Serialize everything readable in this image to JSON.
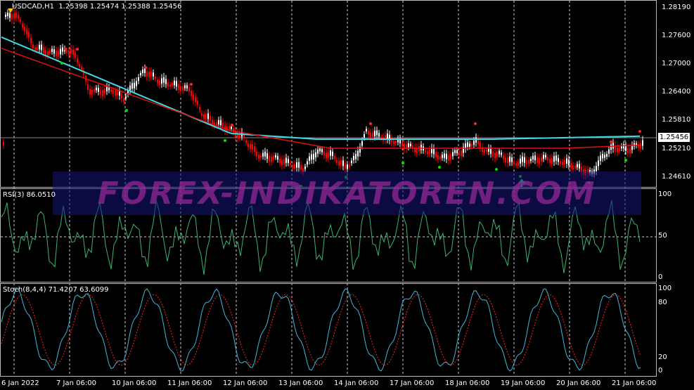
{
  "chart": {
    "symbol_label": "USDCAD,H1",
    "ohlc": [
      "1.25398",
      "1.25474",
      "1.25388",
      "1.25456"
    ],
    "current_price": "1.25456",
    "price_ticks": [
      "1.28190",
      "1.27600",
      "1.27000",
      "1.26400",
      "1.25810",
      "1.25210",
      "1.24610"
    ],
    "time_labels": [
      "6 Jan 2022",
      "7 Jan 06:00",
      "10 Jan 06:00",
      "11 Jan 06:00",
      "12 Jan 06:00",
      "13 Jan 06:00",
      "14 Jan 06:00",
      "17 Jan 06:00",
      "18 Jan 06:00",
      "19 Jan 06:00",
      "20 Jan 06:00",
      "21 Jan 06:00"
    ],
    "watermark": "FOREX-INDIKATOREN.COM",
    "colors": {
      "bull": "#ffffff",
      "bear": "#ff0000",
      "slow_ma": "#3fd9e8",
      "fast_ma": "#e01010",
      "dot_up": "#00e000",
      "dot_down": "#ff2020",
      "grid": "#cfcfcf",
      "arrow": "#00ff66",
      "marker": "#ffcc00"
    }
  },
  "rsi": {
    "title": "RSI(3) 86.0510",
    "levels": [
      "100",
      "50",
      "0"
    ],
    "color": "#3cb371"
  },
  "stoch": {
    "title": "Stoch(8,4,4) 71.4207 63.6099",
    "levels": [
      "100",
      "80",
      "20",
      "0"
    ],
    "main_color": "#3fb8d9",
    "signal_color": "#ff2020"
  }
}
